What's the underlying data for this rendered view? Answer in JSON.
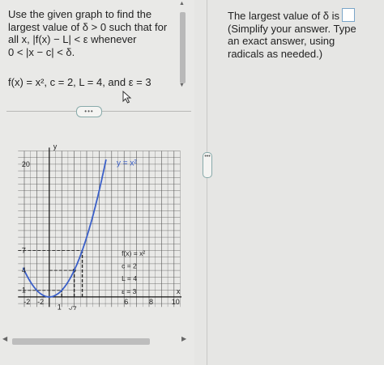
{
  "question": {
    "lines": [
      "Use the given graph to find the",
      "largest value of δ > 0 such that for",
      "all x, |f(x) − L| < ε whenever",
      "0 < |x − c| < δ."
    ],
    "function_line": "f(x) = x², c = 2, L = 4, and ε = 3"
  },
  "more_button": "•••",
  "graph": {
    "curve_label": "y = x²",
    "x_axis_label": "x",
    "y_axis_label": "y",
    "y_ticks": [
      "20",
      "7",
      "4",
      "1"
    ],
    "x_ticks": [
      "-2",
      "-2",
      "1",
      "√7",
      "6",
      "8",
      "10"
    ],
    "legend": [
      "f(x) = x²",
      "c = 2",
      "L = 4",
      "ε = 3"
    ]
  },
  "answer": {
    "lines": [
      "The largest value of δ is",
      "(Simplify your answer. Type",
      "an exact answer, using",
      "radicals as needed.)"
    ],
    "input_value": ""
  },
  "divider_handle": "•••"
}
